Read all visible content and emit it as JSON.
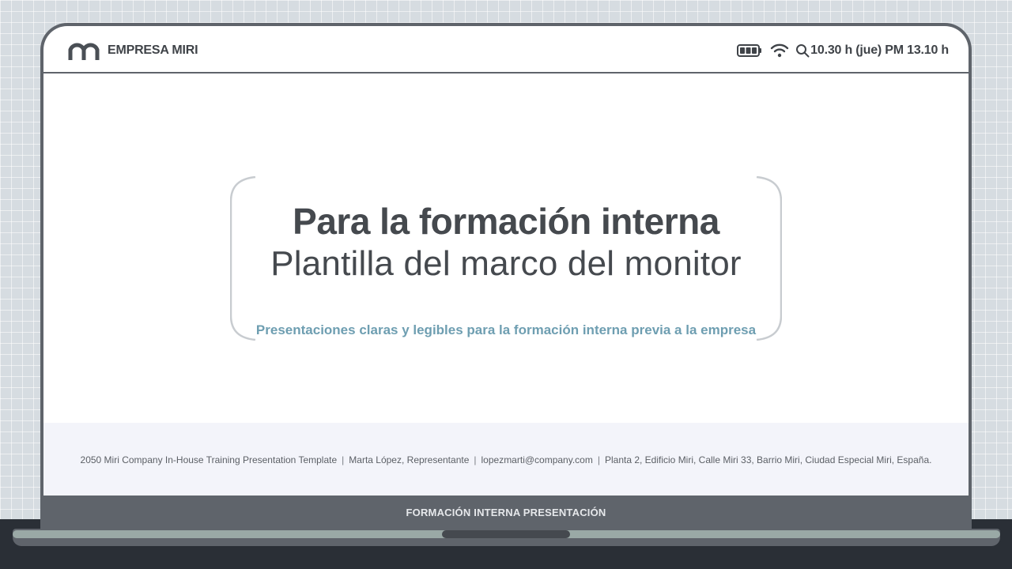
{
  "company": {
    "name": "EMPRESA MIRI",
    "logo_icon": "m-logo-icon"
  },
  "status_bar": {
    "battery_icon": "battery-icon",
    "wifi_icon": "wifi-icon",
    "search_icon": "search-icon",
    "time": "10.30 h (jue) PM 13.10 h"
  },
  "hero": {
    "title": "Para la formación interna",
    "subtitle": "Plantilla del marco del monitor",
    "tagline": "Presentaciones claras y legibles para la formación interna previa a la empresa"
  },
  "footer": {
    "items": [
      "2050 Miri Company In-House Training Presentation Template",
      "Marta López, Representante",
      "lopezmarti@company.com",
      "Planta 2, Edificio Miri, Calle Miri 33, Barrio Miri, Ciudad Especial Miri, España."
    ],
    "separator": "|"
  },
  "bezel": {
    "label": "FORMACIÓN INTERNA PRESENTACIÓN"
  },
  "colors": {
    "background": "#d6dce1",
    "frame": "#5f646b",
    "text_dark": "#45494e",
    "accent": "#6e9eb1",
    "footer_band": "#f3f4fa",
    "desk": "#2a2f36"
  }
}
